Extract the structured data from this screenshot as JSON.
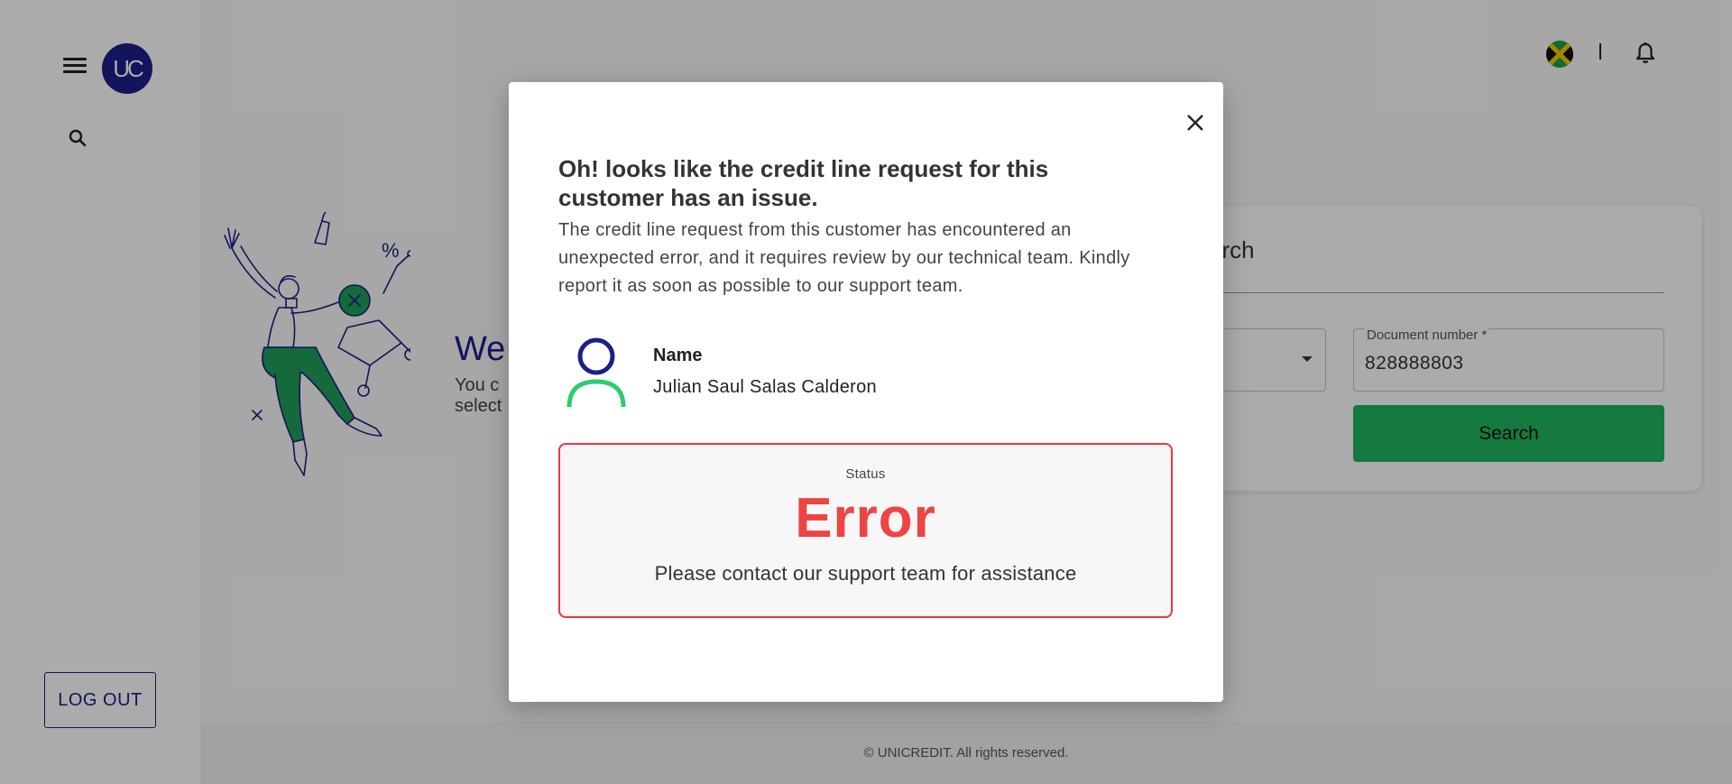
{
  "brand": {
    "logo_text": "UC",
    "primary_color": "#1b1f8a",
    "accent_color": "#1fb660"
  },
  "sidebar": {
    "menu_icon": "hamburger-menu-icon",
    "search_icon": "search-icon",
    "logout_label": "LOG OUT"
  },
  "header": {
    "country_flag": "jamaica-flag",
    "notification_icon": "bell-icon"
  },
  "welcome": {
    "title": "We",
    "text_line1": "You c",
    "text_line2": "select"
  },
  "search_card": {
    "title": "arch",
    "document_type_value": "",
    "document_number_label": "Document number *",
    "document_number_value": "828888803",
    "search_button_label": "Search"
  },
  "modal": {
    "close_icon": "close-icon",
    "title": "Oh! looks like the credit line request for this customer has an issue.",
    "description": "The credit line request from this customer has encountered an unexpected error, and it requires review by our technical team. Kindly report it as soon as possible to our support team.",
    "customer": {
      "name_label": "Name",
      "name_value": "Julian Saul Salas Calderon"
    },
    "status": {
      "label": "Status",
      "value": "Error",
      "message": "Please contact our support team for assistance",
      "color": "#ee4444"
    }
  },
  "footer": {
    "copyright": "© UNICREDIT. All rights reserved."
  }
}
